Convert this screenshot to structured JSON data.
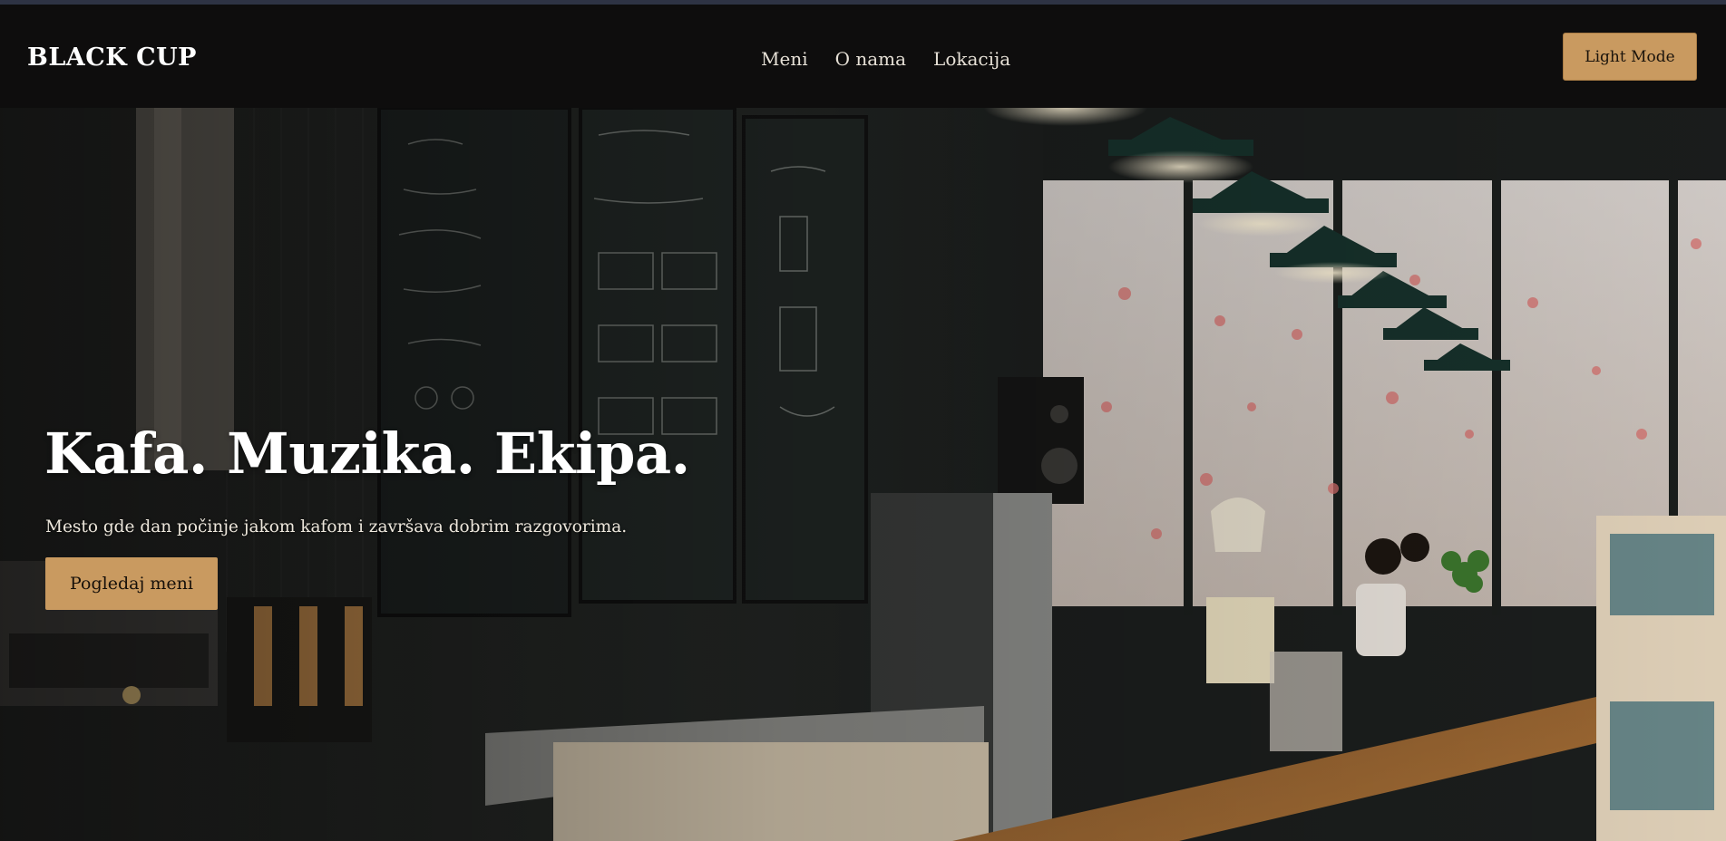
{
  "navbar": {
    "brand": "BLACK CUP",
    "links": [
      "Meni",
      "O nama",
      "Lokacija"
    ],
    "mode_toggle_label": "Light Mode"
  },
  "hero": {
    "title": "Kafa. Muzika. Ekipa.",
    "subtitle": "Mesto gde dan počinje jakom kafom i završava dobrim razgovorima.",
    "cta_label": "Pogledaj meni",
    "background_image": "coffee-shop-interior-photo"
  },
  "colors": {
    "accent": "#c99a60",
    "navbar_bg": "#0e0d0d",
    "text_light": "#ffffff"
  }
}
